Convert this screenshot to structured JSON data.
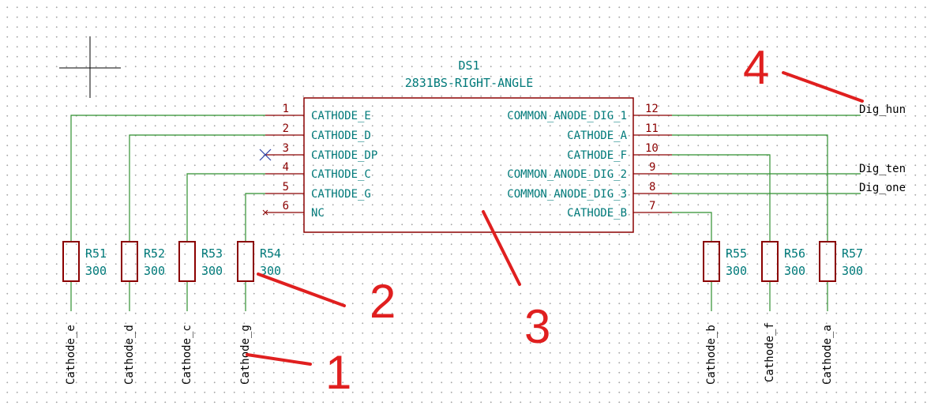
{
  "schematic": {
    "component": {
      "reference": "DS1",
      "value": "2831BS-RIGHT-ANGLE",
      "pins_left": [
        {
          "number": "1",
          "name": "CATHODE_E"
        },
        {
          "number": "2",
          "name": "CATHODE_D"
        },
        {
          "number": "3",
          "name": "CATHODE_DP"
        },
        {
          "number": "4",
          "name": "CATHODE_C"
        },
        {
          "number": "5",
          "name": "CATHODE_G"
        },
        {
          "number": "6",
          "name": "NC"
        }
      ],
      "pins_right": [
        {
          "number": "12",
          "name": "COMMON_ANODE_DIG_1"
        },
        {
          "number": "11",
          "name": "CATHODE_A"
        },
        {
          "number": "10",
          "name": "CATHODE_F"
        },
        {
          "number": "9",
          "name": "COMMON_ANODE_DIG_2"
        },
        {
          "number": "8",
          "name": "COMMON_ANODE_DIG_3"
        },
        {
          "number": "7",
          "name": "CATHODE_B"
        }
      ]
    },
    "resistors": [
      {
        "ref": "R51",
        "value": "300",
        "net": "Cathode_e"
      },
      {
        "ref": "R52",
        "value": "300",
        "net": "Cathode_d"
      },
      {
        "ref": "R53",
        "value": "300",
        "net": "Cathode_c"
      },
      {
        "ref": "R54",
        "value": "300",
        "net": "Cathode_g"
      },
      {
        "ref": "R55",
        "value": "300",
        "net": "Cathode_b"
      },
      {
        "ref": "R56",
        "value": "300",
        "net": "Cathode_f"
      },
      {
        "ref": "R57",
        "value": "300",
        "net": "Cathode_a"
      }
    ],
    "net_labels_right": [
      "Dig_hun",
      "Dig_ten",
      "Dig_one"
    ],
    "annotations": [
      "1",
      "2",
      "3",
      "4"
    ],
    "colors": {
      "wire": "#2f8f2f",
      "body": "#8b0000",
      "pin_text": "#007a7a",
      "pin_number": "#8b0000",
      "annotation": "#e01f1f"
    }
  }
}
